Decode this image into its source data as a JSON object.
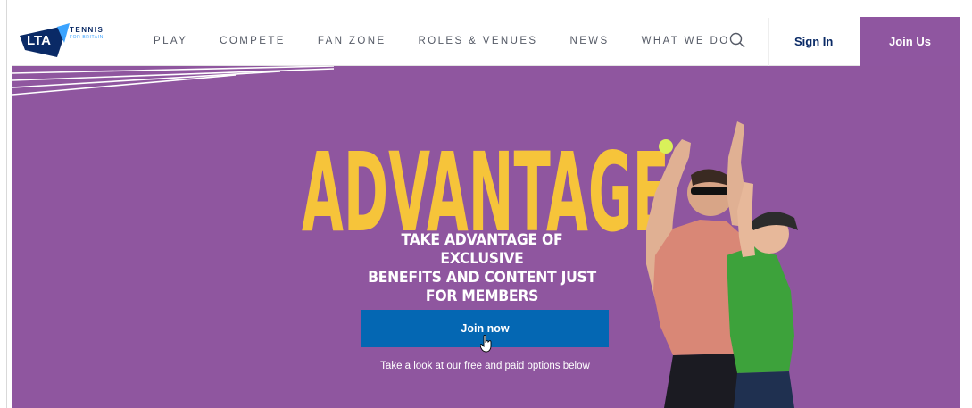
{
  "header": {
    "logo_text": "LTA",
    "logo_tagline": "TENNIS",
    "logo_subtagline": "FOR BRITAIN",
    "nav": [
      {
        "label": "PLAY"
      },
      {
        "label": "COMPETE"
      },
      {
        "label": "FAN ZONE"
      },
      {
        "label": "ROLES & VENUES"
      },
      {
        "label": "NEWS"
      },
      {
        "label": "WHAT WE DO"
      }
    ],
    "search_icon": "search-icon",
    "sign_in": "Sign In",
    "join_us": "Join Us"
  },
  "hero": {
    "headline": "ADVANTAGE",
    "subheadline_lines": [
      "TAKE ADVANTAGE OF EXCLUSIVE",
      "BENEFITS AND CONTENT JUST",
      "FOR MEMBERS"
    ],
    "cta": "Join now",
    "note": "Take a look at our free and paid options below"
  },
  "colors": {
    "brand_navy": "#0a2a66",
    "hero_purple": "#8f569f",
    "join_us_purple": "#8f56a0",
    "headline_yellow": "#f6c43a",
    "cta_blue": "#0467b3"
  }
}
